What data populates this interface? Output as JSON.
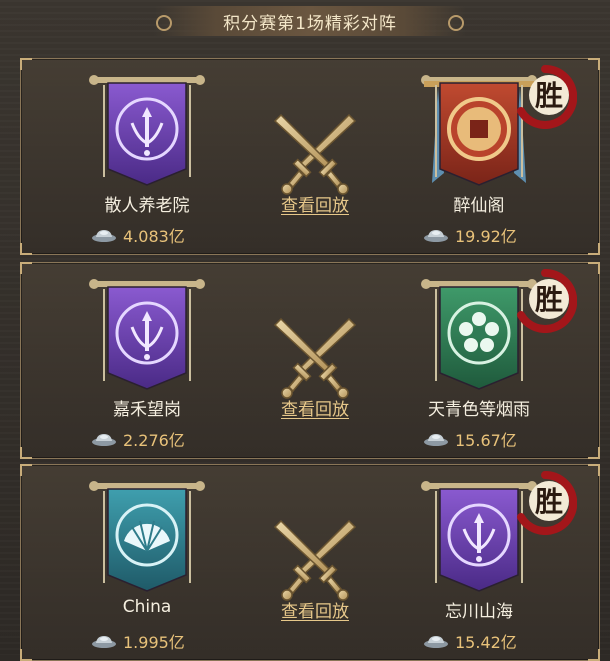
{
  "header": {
    "title": "积分赛第1场精彩对阵"
  },
  "replay_label": "查看回放",
  "win_label": "胜",
  "colors": {
    "gold": "#e8c27a",
    "purple": "#6b3fb0",
    "red": "#9e2f22",
    "green": "#2f7a55",
    "teal": "#2f7c8a"
  },
  "matches": [
    {
      "left": {
        "name": "散人养老院",
        "score": "4.083亿",
        "banner": "purple-sword-icon"
      },
      "right": {
        "name": "醉仙阁",
        "score": "19.92亿",
        "banner": "red-coin-icon"
      },
      "winner": "right"
    },
    {
      "left": {
        "name": "嘉禾望岗",
        "score": "2.276亿",
        "banner": "purple-sword-icon"
      },
      "right": {
        "name": "天青色等烟雨",
        "score": "15.67亿",
        "banner": "green-flower-icon"
      },
      "winner": "right"
    },
    {
      "left": {
        "name": "China",
        "score": "1.995亿",
        "banner": "teal-fan-icon"
      },
      "right": {
        "name": "忘川山海",
        "score": "15.42亿",
        "banner": "purple-sword-icon"
      },
      "winner": "right"
    }
  ]
}
